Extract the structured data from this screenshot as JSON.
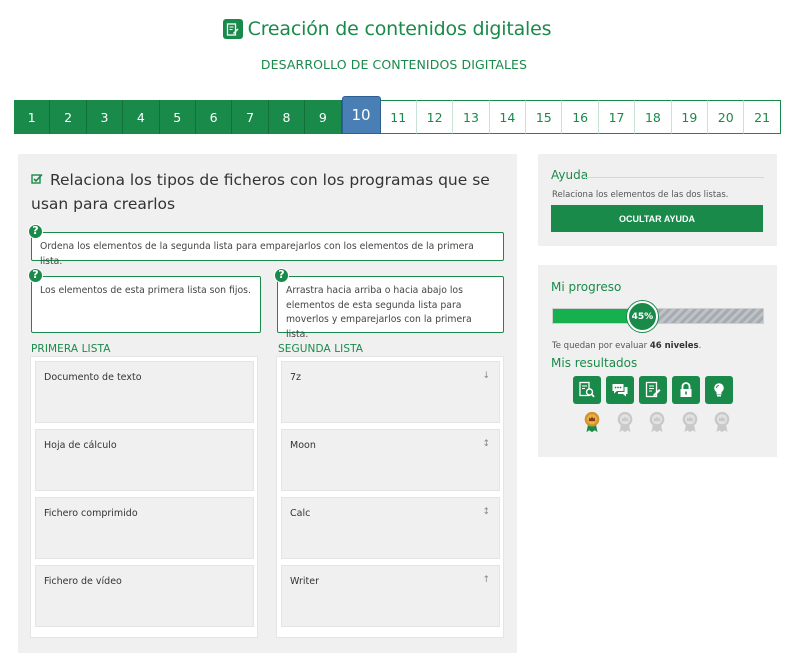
{
  "header": {
    "title": "Creación de contenidos digitales",
    "subtitle": "DESARROLLO DE CONTENIDOS DIGITALES"
  },
  "pager": {
    "pages": [
      "1",
      "2",
      "3",
      "4",
      "5",
      "6",
      "7",
      "8",
      "9",
      "10",
      "11",
      "12",
      "13",
      "14",
      "15",
      "16",
      "17",
      "18",
      "19",
      "20",
      "21"
    ],
    "current": "10"
  },
  "exercise": {
    "question": "Relaciona los tipos de ficheros con los programas que se usan para crearlos",
    "hint_main": "Ordena los elementos de la segunda lista para emparejarlos con los elementos de la primera lista.",
    "hint_first": "Los elementos de esta primera lista son fijos.",
    "hint_second": "Arrastra hacia arriba o hacia abajo los elementos de esta segunda lista para moverlos y emparejarlos con la primera lista.",
    "first_list_title": "PRIMERA LISTA",
    "second_list_title": "SEGUNDA LISTA",
    "first_list": [
      "Documento de texto",
      "Hoja de cálculo",
      "Fichero comprimido",
      "Fichero de vídeo"
    ],
    "second_list": [
      "7z",
      "Moon",
      "Calc",
      "Writer"
    ],
    "second_list_arrows": [
      "↓",
      "↕",
      "↕",
      "↑"
    ]
  },
  "help": {
    "title": "Ayuda",
    "description": "Relaciona los elementos de las dos listas.",
    "hide_button": "OCULTAR AYUDA"
  },
  "progress": {
    "title": "Mi progreso",
    "percent": 45,
    "percent_label": "45%",
    "remaining_prefix": "Te quedan por evaluar ",
    "remaining_bold": "46 niveles",
    "remaining_suffix": ".",
    "results_title": "Mis resultados",
    "result_icons": [
      "search-document-icon",
      "chat-icon",
      "edit-document-icon",
      "lock-icon",
      "lightbulb-icon"
    ],
    "medals_earned": 1,
    "medals_total": 5
  },
  "colors": {
    "primary_green": "#1a8a4a",
    "progress_green": "#16b04f",
    "current_page_blue": "#4a7fb5",
    "medal_gold": "#d4922a"
  }
}
